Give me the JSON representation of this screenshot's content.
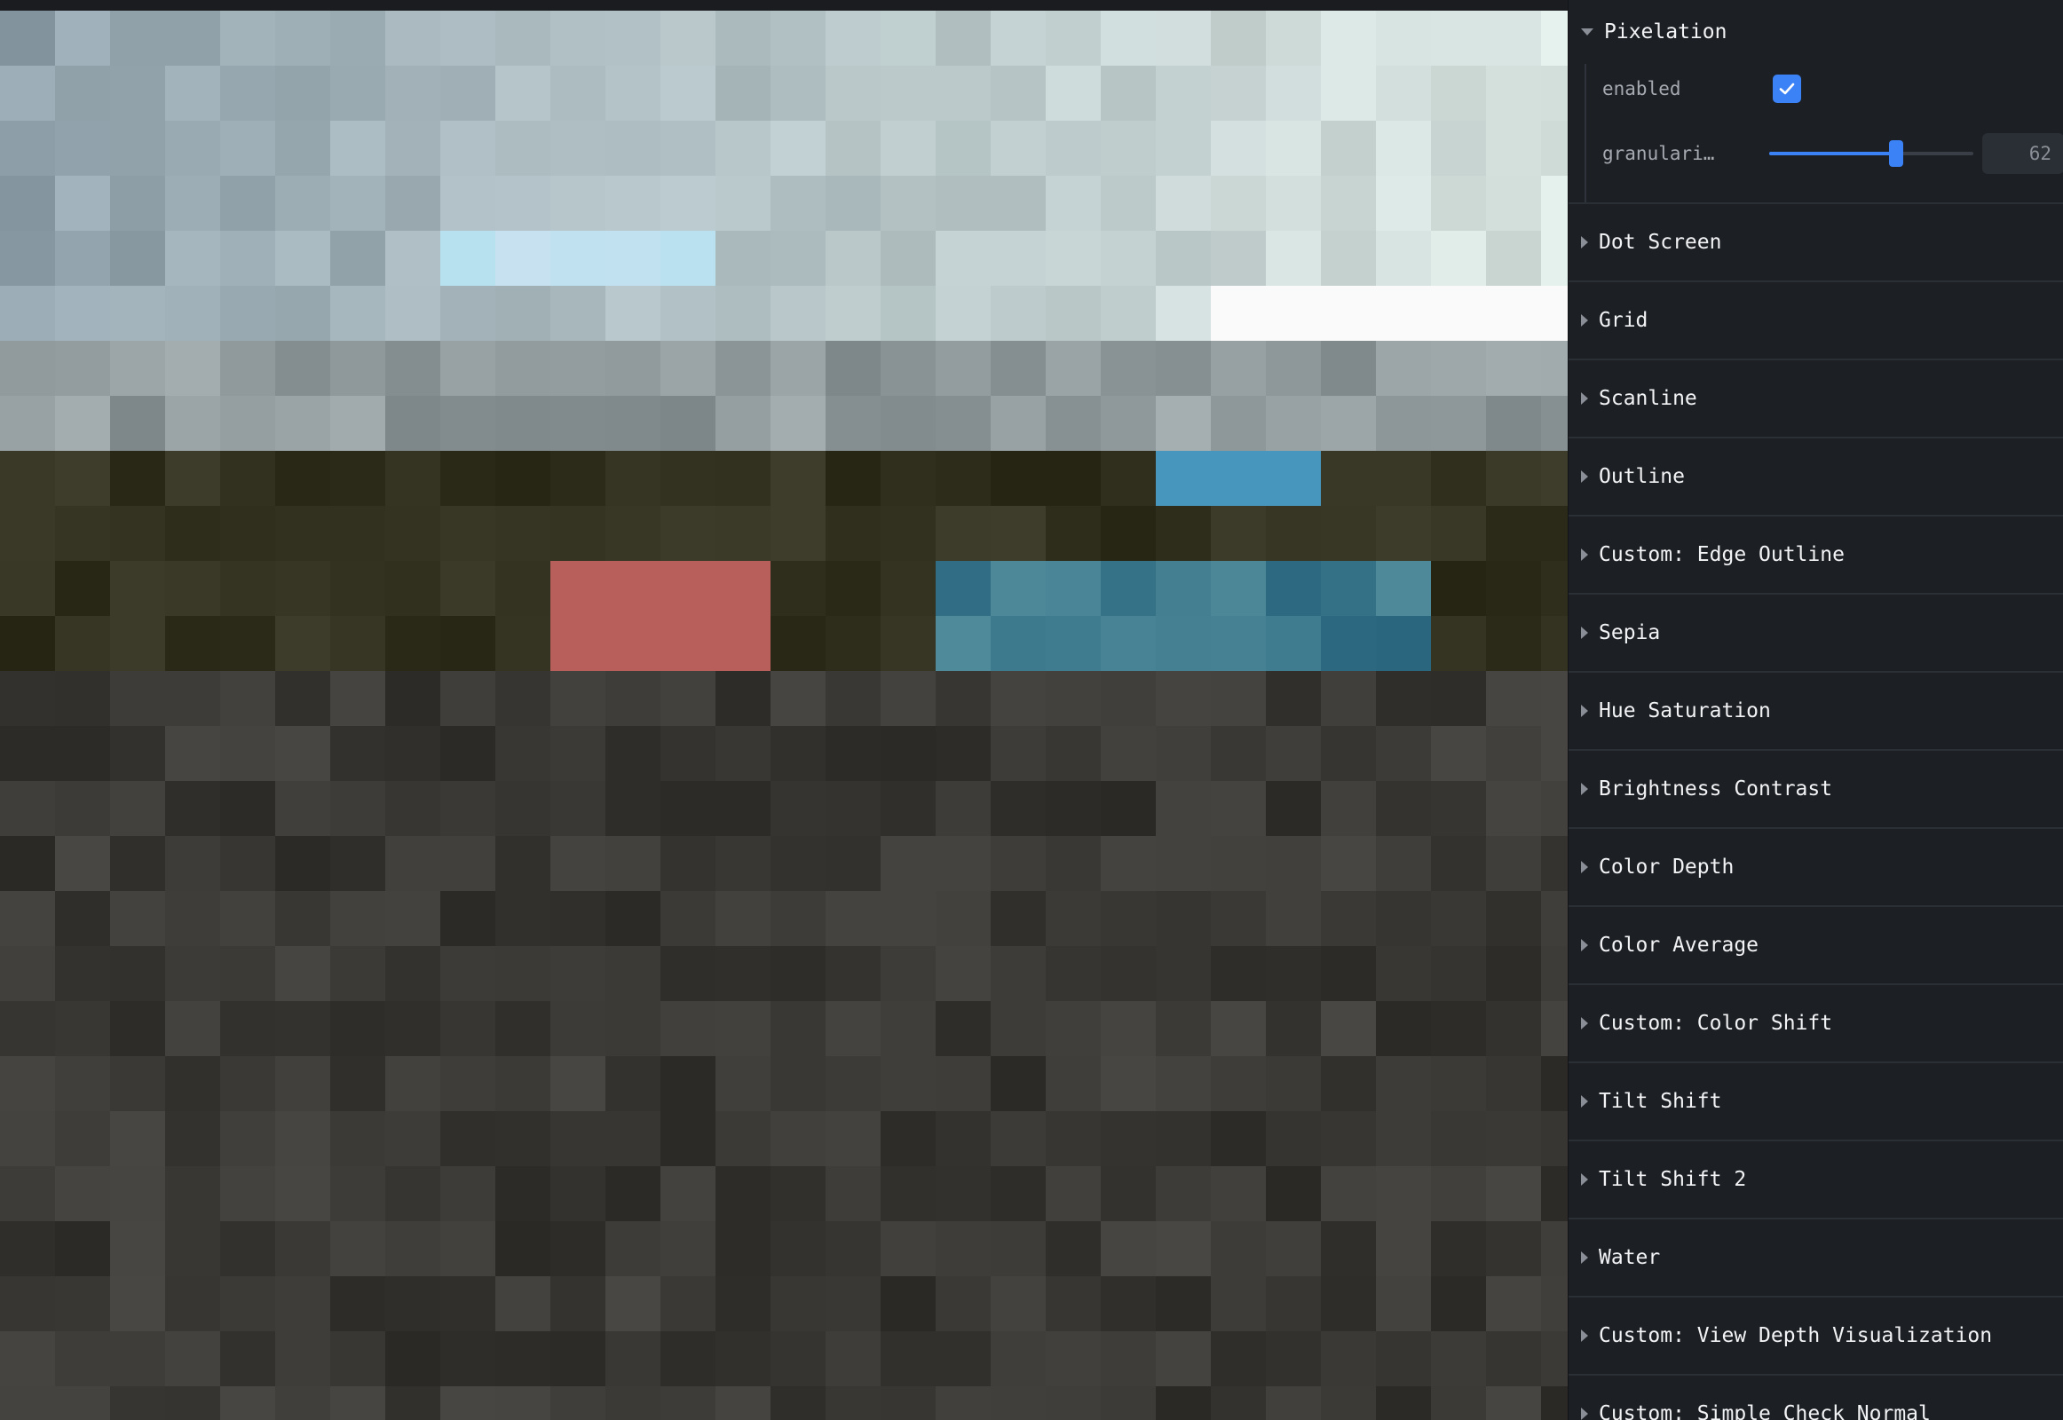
{
  "panel": {
    "folders": [
      {
        "label": "Pixelation",
        "open": true,
        "props": [
          {
            "label": "enabled",
            "type": "checkbox",
            "value": true
          },
          {
            "label": "granulari…",
            "type": "slider",
            "value": 62,
            "min": 0,
            "max": 100,
            "display": "62"
          }
        ]
      },
      {
        "label": "Dot Screen",
        "open": false
      },
      {
        "label": "Grid",
        "open": false
      },
      {
        "label": "Scanline",
        "open": false
      },
      {
        "label": "Outline",
        "open": false
      },
      {
        "label": "Custom: Edge Outline",
        "open": false
      },
      {
        "label": "Sepia",
        "open": false
      },
      {
        "label": "Hue Saturation",
        "open": false
      },
      {
        "label": "Brightness Contrast",
        "open": false
      },
      {
        "label": "Color Depth",
        "open": false
      },
      {
        "label": "Color Average",
        "open": false
      },
      {
        "label": "Custom: Color Shift",
        "open": false
      },
      {
        "label": "Tilt Shift",
        "open": false
      },
      {
        "label": "Tilt Shift 2",
        "open": false
      },
      {
        "label": "Water",
        "open": false
      },
      {
        "label": "Custom: View Depth Visualization",
        "open": false
      },
      {
        "label": "Custom: Simple Check Normal",
        "open": false
      }
    ]
  },
  "colors": {
    "accent": "#3b82f6",
    "panel_bg": "#1c1f24"
  }
}
